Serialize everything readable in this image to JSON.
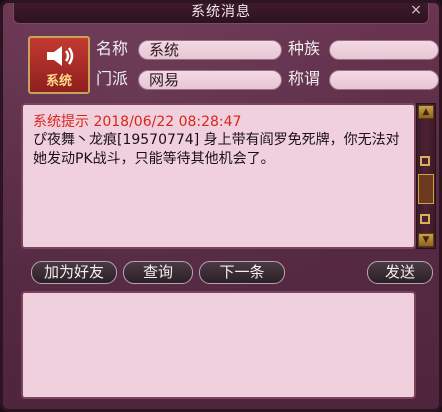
{
  "window": {
    "title": "系统消息",
    "close": "×"
  },
  "avatar": {
    "label": "系统"
  },
  "info": {
    "name_label": "名称",
    "name_value": "系统",
    "race_label": "种族",
    "race_value": "",
    "sect_label": "门派",
    "sect_value": "网易",
    "title_label": "称谓",
    "title_value": ""
  },
  "message": {
    "header": "系统提示 2018/06/22 08:28:47",
    "body": "ぴ夜舞丶龙痕[19570774] 身上带有阎罗免死牌，你无法对她发动PK战斗，只能等待其他机会了。"
  },
  "buttons": {
    "add_friend": "加为好友",
    "query": "查询",
    "next": "下一条",
    "send": "发送"
  },
  "input": {
    "value": ""
  }
}
